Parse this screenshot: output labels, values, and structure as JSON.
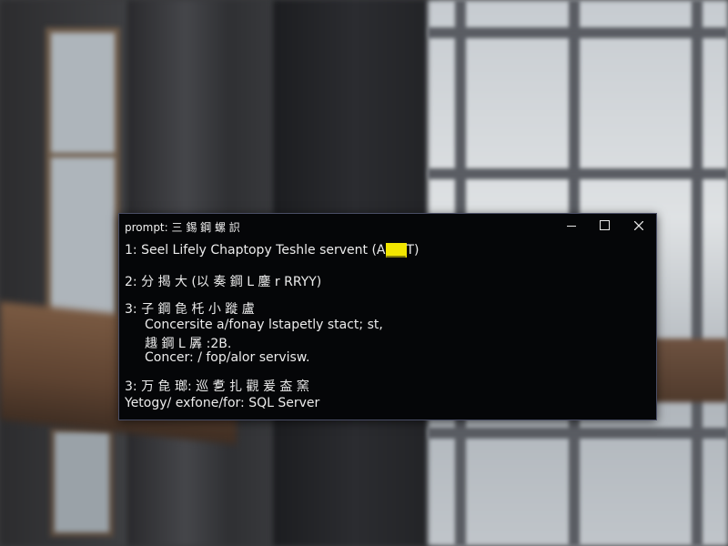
{
  "window": {
    "title": "prompt: 三 錫 鋼 螺 䛊",
    "controls": {
      "minimize_icon": "minimize-icon",
      "maximize_icon": "maximize-icon",
      "close_icon": "close-icon"
    }
  },
  "console": {
    "line1_prefix": "1: Seel Lifely Chaptopy Teshle servent (A",
    "line1_highlight": "___",
    "line1_suffix": "T)",
    "line2": "2: 分 揭 ⼤ (以 奏 鋼 L 鏖 r RRYY)",
    "line3": "3: 子 鋼 㲋 杔 小 蹝 盧",
    "line3a": "Concersite a/fonay lstapetly stact; st,",
    "line3b": "䞲 鋼 L 羼 :2B.",
    "line3c": "Concer: / fop/alor servisw.",
    "line4": "3: 万 㲋 瑯: 巡 乽 扎 觀 爰 盇 窯",
    "line5": "Yetogy/ exfone/for: SQL Server"
  },
  "colors": {
    "console_bg": "#050608",
    "console_text": "#ececec",
    "highlight": "#f2e600"
  }
}
